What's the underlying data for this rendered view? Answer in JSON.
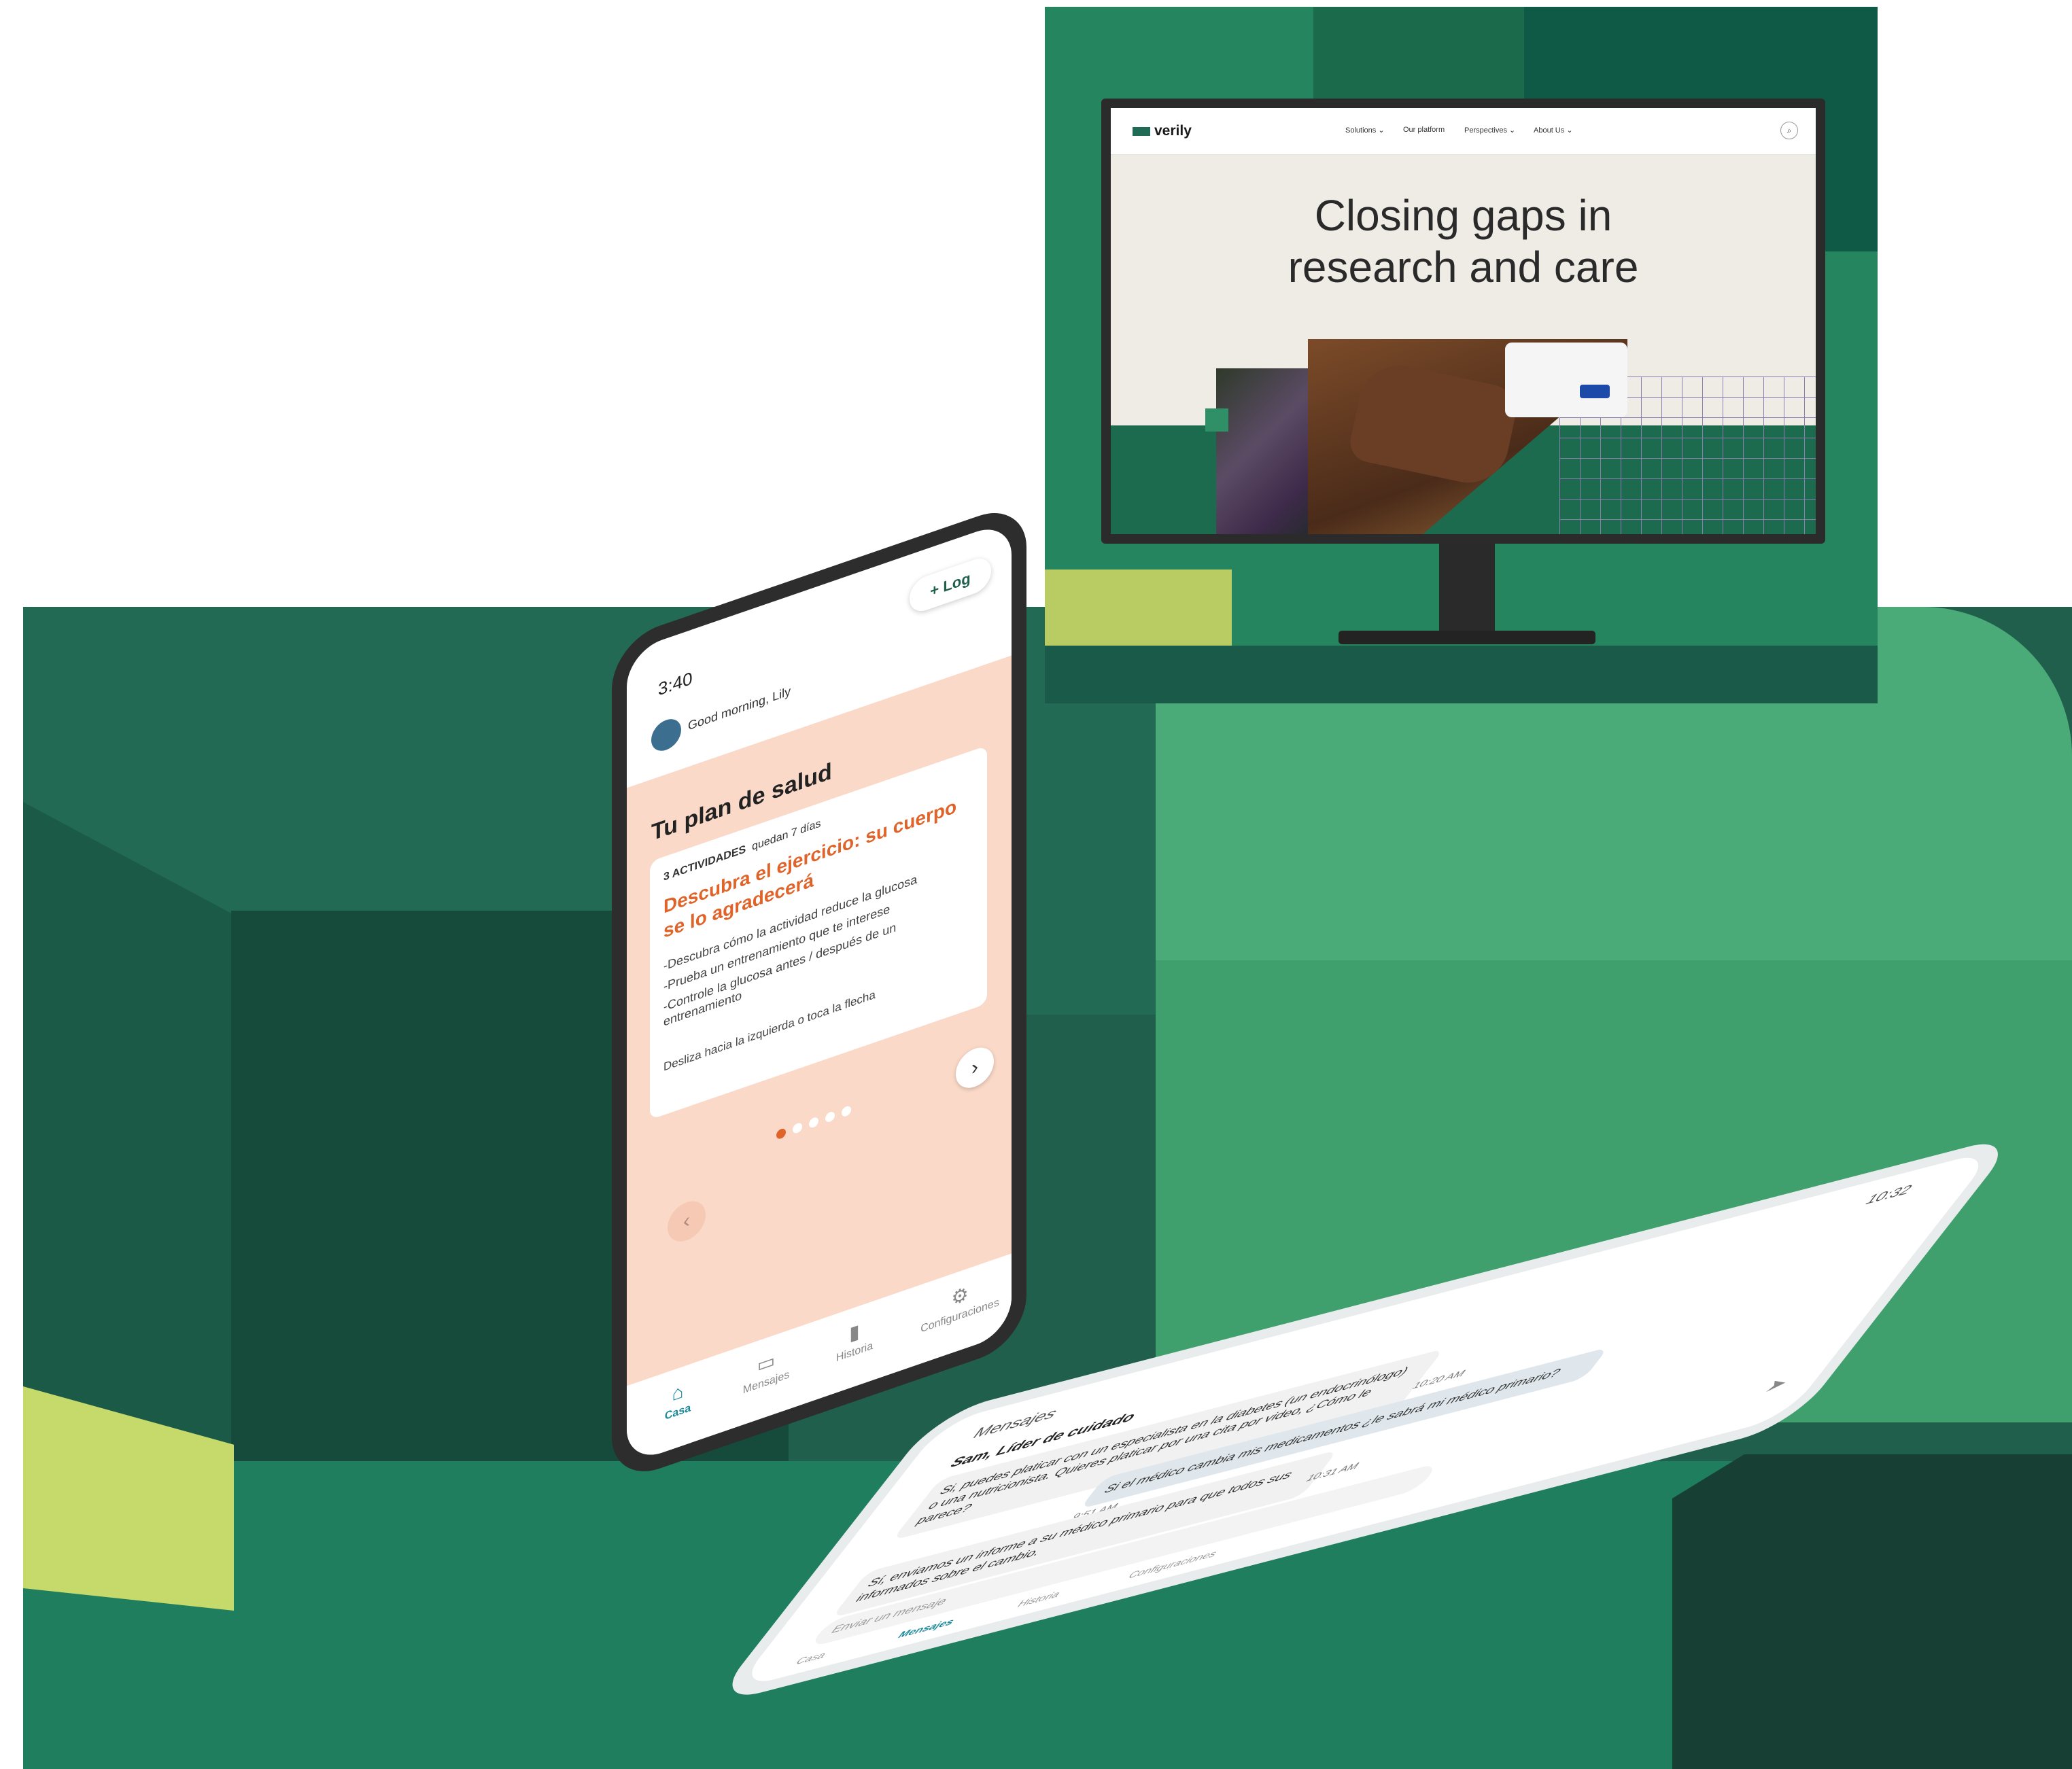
{
  "website": {
    "logo_text": "verily",
    "nav": [
      "Solutions",
      "Our platform",
      "Perspectives",
      "About Us"
    ],
    "nav_carets": [
      "⌄",
      "",
      "⌄",
      "⌄"
    ],
    "search_icon": "search-icon",
    "hero_line1": "Closing gaps in",
    "hero_line2": "research and care"
  },
  "phone_home": {
    "time": "3:40",
    "log_button": "+ Log",
    "greeting": "Good morning, Lily",
    "plan_title": "Tu plan de salud",
    "card": {
      "activities": "3 ACTIVIDADES",
      "remaining": "quedan 7 días",
      "title": "Descubra el ejercicio: su cuerpo se lo agradecerá",
      "items": [
        "-Descubra cómo la actividad reduce la glucosa",
        "-Prueba un entrenamiento que te interese",
        "-Controle la glucosa antes / después de un entrenamiento"
      ],
      "hint": "Desliza hacia la izquierda o toca la flecha"
    },
    "next_icon": "›",
    "prev_icon": "‹",
    "tabs": [
      {
        "label": "Casa",
        "icon": "⌂",
        "active": true
      },
      {
        "label": "Mensajes",
        "icon": "▭",
        "active": false
      },
      {
        "label": "Historia",
        "icon": "▮",
        "active": false
      },
      {
        "label": "Configuraciones",
        "icon": "⚙",
        "active": false
      }
    ]
  },
  "phone_messages": {
    "header": "Mensajes",
    "time": "10:32",
    "sender": "Sam, Líder de cuidado",
    "messages": [
      {
        "text": "Si, puedes platicar con un especialista en la diabetes (un endocrinólogo) o una nutricionista. Quieres platicar por una cita por video, ¿Cómo le parece?",
        "stamp": "10:20 AM",
        "me": false
      },
      {
        "text": "Si el médico cambia mis medicamentos ¿le sabrá mi médico primario?",
        "stamp": "9:51 AM",
        "me": true
      },
      {
        "text": "Sí, enviamos un informe a su médico primario para que todos sus informados sobre el cambio.",
        "stamp": "10:31 AM",
        "me": false
      }
    ],
    "input_placeholder": "Enviar un mensaje",
    "tabs": [
      "Casa",
      "Mensajes",
      "Historia",
      "Configuraciones"
    ]
  }
}
